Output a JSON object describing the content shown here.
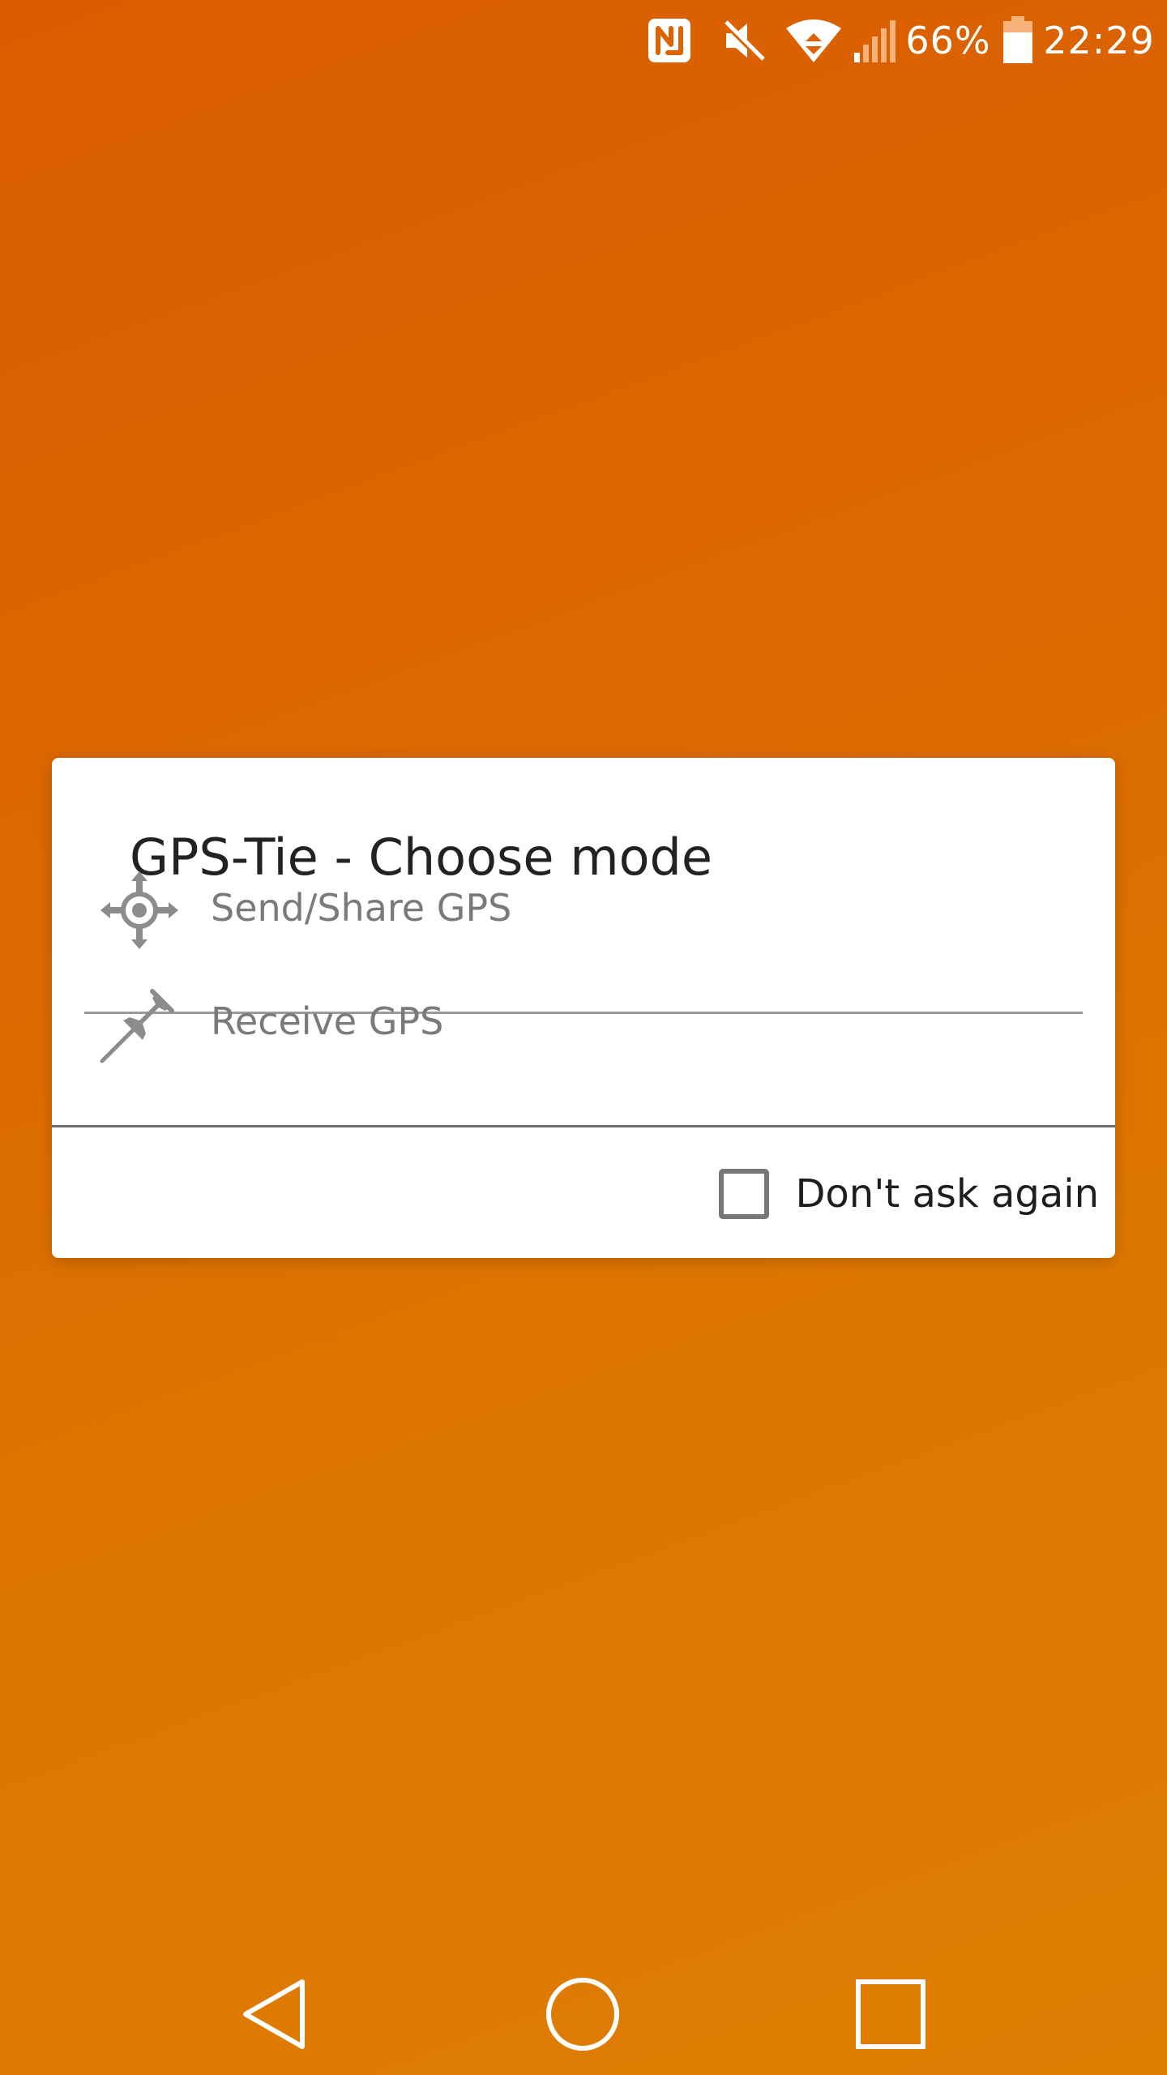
{
  "status_bar": {
    "icons": [
      "nfc-icon",
      "mute-icon",
      "wifi-icon",
      "signal-icon",
      "battery-icon"
    ],
    "battery": "66%",
    "time": "22:29"
  },
  "dialog": {
    "title": "GPS-Tie - Choose mode",
    "options": [
      {
        "label": "Send/Share GPS",
        "icon": "gps-crosshair-icon"
      },
      {
        "label": "Receive GPS",
        "icon": "pushpin-icon"
      }
    ],
    "dont_ask_label": "Don't ask again",
    "dont_ask_checked": false
  },
  "nav_bar": {
    "buttons": [
      "back-icon",
      "home-icon",
      "recents-icon"
    ]
  },
  "colors": {
    "background_top": "#da5c00",
    "background_bottom": "#df7d03",
    "dialog_bg": "#ffffff",
    "option_text": "#7a7a7a",
    "title_text": "#222222"
  }
}
